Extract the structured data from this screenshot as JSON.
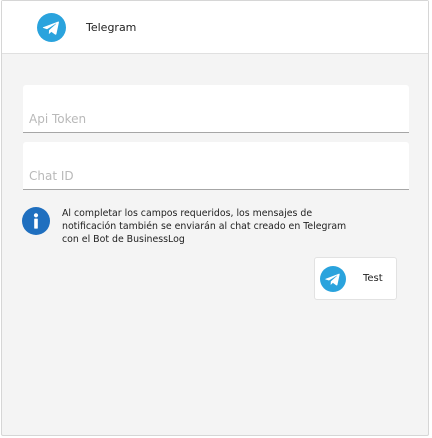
{
  "header": {
    "title": "Telegram",
    "icon": "telegram-icon"
  },
  "form": {
    "api_token": {
      "placeholder": "Api Token",
      "value": ""
    },
    "chat_id": {
      "placeholder": "Chat ID",
      "value": ""
    }
  },
  "info": {
    "icon": "info-icon",
    "text": "Al completar los campos requeridos, los mensajes de notificación también se enviarán al chat creado en Telegram con el Bot de BusinessLog"
  },
  "test_button": {
    "label": "Test",
    "icon": "telegram-icon"
  },
  "colors": {
    "telegram_blue": "#2aa3dd",
    "info_blue": "#1f6fbf",
    "panel_bg": "#f4f4f4"
  }
}
